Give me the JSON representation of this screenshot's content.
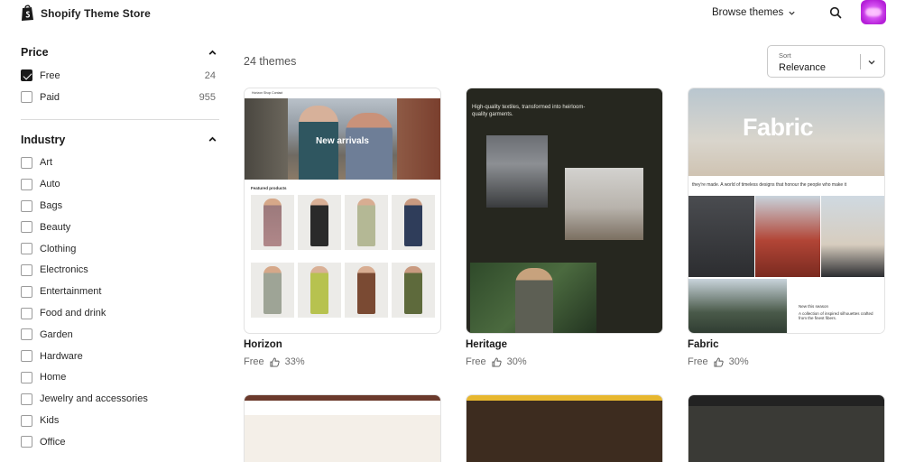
{
  "header": {
    "brand": "Shopify Theme Store",
    "browse_label": "Browse themes"
  },
  "filters": {
    "price": {
      "title": "Price",
      "options": [
        {
          "label": "Free",
          "count": "24",
          "checked": true
        },
        {
          "label": "Paid",
          "count": "955",
          "checked": false
        }
      ]
    },
    "industry": {
      "title": "Industry",
      "options": [
        {
          "label": "Art"
        },
        {
          "label": "Auto"
        },
        {
          "label": "Bags"
        },
        {
          "label": "Beauty"
        },
        {
          "label": "Clothing"
        },
        {
          "label": "Electronics"
        },
        {
          "label": "Entertainment"
        },
        {
          "label": "Food and drink"
        },
        {
          "label": "Garden"
        },
        {
          "label": "Hardware"
        },
        {
          "label": "Home"
        },
        {
          "label": "Jewelry and accessories"
        },
        {
          "label": "Kids"
        },
        {
          "label": "Office"
        }
      ]
    }
  },
  "results": {
    "count_label": "24 themes"
  },
  "sort": {
    "label": "Sort",
    "value": "Relevance"
  },
  "themes": [
    {
      "name": "Horizon",
      "price": "Free",
      "rating": "33%",
      "preview": {
        "nav": "Horizon   Shop   Contact",
        "hero_title": "New arrivals",
        "section_title": "Featured products"
      }
    },
    {
      "name": "Heritage",
      "price": "Free",
      "rating": "30%",
      "preview": {
        "headline": "High-quality textiles, transformed into heirloom-quality garments."
      }
    },
    {
      "name": "Fabric",
      "price": "Free",
      "rating": "30%",
      "preview": {
        "hero_title": "Fabric",
        "strip_text": "they're made.  A world of timeless designs that honour the people who make it",
        "season_title": "New this season",
        "season_text": "A collection of inspired silhouettes crafted from the finest fibers."
      }
    }
  ],
  "colors": {
    "accent": "#1a1a1a",
    "muted": "#6b6b6b",
    "avatar": "#c83ae6"
  }
}
